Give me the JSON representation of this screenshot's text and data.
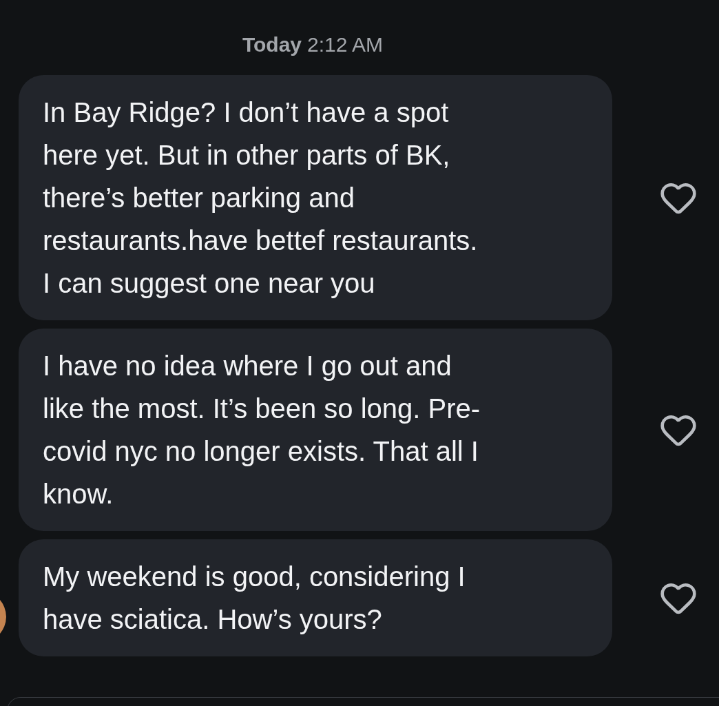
{
  "timestamp": {
    "day": "Today",
    "time": "2:12 AM"
  },
  "messages": [
    {
      "lines": [
        "In Bay Ridge? I don’t have a spot",
        "here yet. But in other parts of BK,",
        "there’s better parking and",
        "restaurants.have bettef restaurants.",
        "I can suggest one near you"
      ],
      "liked": false
    },
    {
      "lines": [
        "I have no idea where I go out and",
        "like the most. It’s been so long. Pre-",
        "covid nyc no longer exists. That all I",
        "know."
      ],
      "liked": false
    },
    {
      "lines": [
        "My weekend is good, considering I",
        "have sciatica. How’s yours?"
      ],
      "liked": false,
      "avatar": true
    }
  ]
}
